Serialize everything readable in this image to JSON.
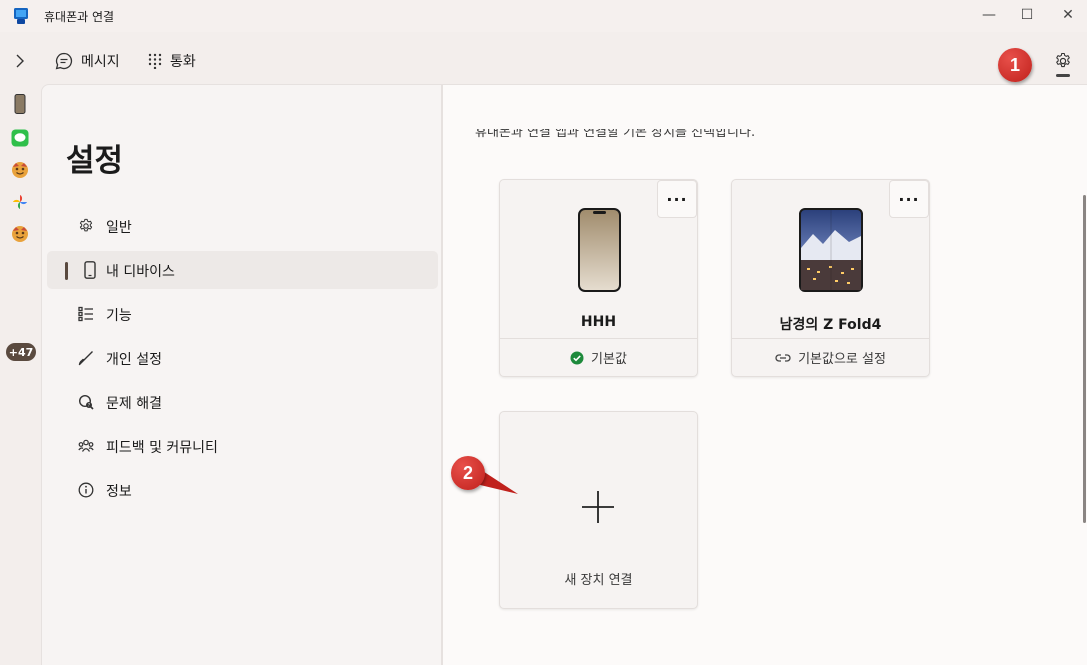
{
  "window": {
    "title": "휴대폰과 연결",
    "controls": {
      "minimize": "—",
      "maximize": "☐",
      "close": "✕"
    }
  },
  "toolbar": {
    "messages_label": "메시지",
    "calls_label": "통화"
  },
  "markers": {
    "first": "1",
    "second": "2"
  },
  "rail": {
    "badge": "+47"
  },
  "settings": {
    "heading": "설정",
    "nav": [
      {
        "label": "일반",
        "icon": "gear-icon"
      },
      {
        "label": "내 디바이스",
        "icon": "phone-icon",
        "selected": true
      },
      {
        "label": "기능",
        "icon": "list-icon"
      },
      {
        "label": "개인 설정",
        "icon": "brush-icon"
      },
      {
        "label": "문제 해결",
        "icon": "troubleshoot-icon"
      },
      {
        "label": "피드백 및 커뮤니티",
        "icon": "people-icon"
      },
      {
        "label": "정보",
        "icon": "info-icon"
      }
    ]
  },
  "content": {
    "description": "휴대폰과 연결 앱과 연결할 기본 장치를 선택합니다.",
    "devices": [
      {
        "name": "HHH",
        "status": "기본값",
        "more": "···"
      },
      {
        "name": "남경의 Z Fold4",
        "action": "기본값으로 설정",
        "more": "···"
      }
    ],
    "add_device_label": "새 장치 연결"
  },
  "colors": {
    "accent": "#5a4a3f",
    "marker": "#d0302a",
    "check": "#1e8a3c"
  }
}
